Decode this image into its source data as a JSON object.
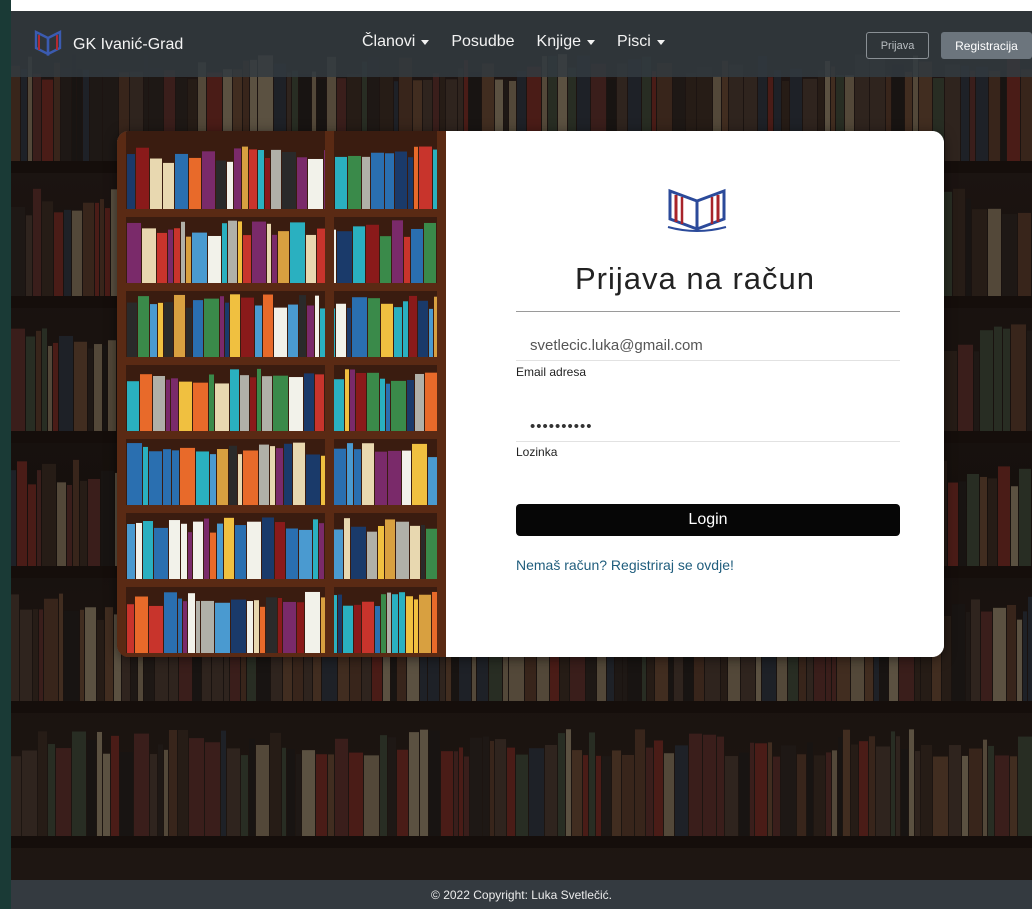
{
  "navbar": {
    "brand": "GK Ivanić-Grad",
    "links": [
      {
        "label": "Članovi",
        "dropdown": true
      },
      {
        "label": "Posudbe",
        "dropdown": false
      },
      {
        "label": "Knjige",
        "dropdown": true
      },
      {
        "label": "Pisci",
        "dropdown": true
      }
    ],
    "login_button": "Prijava",
    "register_button": "Registracija"
  },
  "login_form": {
    "title": "Prijava na račun",
    "email_value": "svetlecic.luka@gmail.com",
    "email_label": "Email adresa",
    "password_value": "••••••••••",
    "password_label": "Lozinka",
    "submit_label": "Login",
    "register_link": "Nemaš račun? Registriraj se ovdje!"
  },
  "footer": {
    "text": "© 2022 Copyright: Luka Svetlečić."
  },
  "colors": {
    "navbar_bg": "#323a40",
    "login_button_bg": "#060606",
    "register_button_bg": "#6c757d",
    "link_color": "#1f5d7d",
    "logo_blue": "#2b4a9a",
    "logo_red": "#a8242a",
    "footer_bg": "#343a40"
  },
  "icons": {
    "brand_logo": "open-book-icon",
    "form_logo": "open-book-icon",
    "dropdown": "caret-down-icon"
  }
}
